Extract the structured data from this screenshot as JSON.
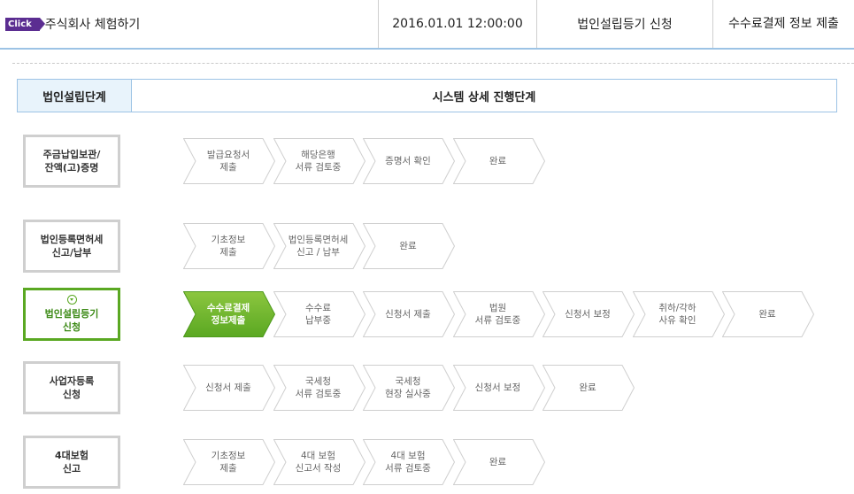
{
  "header": {
    "badge": "Click",
    "title": "주식회사 체험하기",
    "datetime": "2016.01.01 12:00:00",
    "application": "법인설립등기 신청",
    "step": "수수료결제 정보 제출"
  },
  "stage_header": {
    "left": "법인설립단계",
    "right": "시스템 상세 진행단계"
  },
  "rows": [
    {
      "stage": "주금납입보관/\n잔액(고)증명",
      "steps": [
        "발급요청서\n제출",
        "해당은행\n서류 검토중",
        "증명서 확인",
        "완료"
      ]
    },
    {
      "stage": "법인등록면허세\n신고/납부",
      "steps": [
        "기초정보\n제출",
        "법인등록면허세\n신고 / 납부",
        "완료"
      ]
    },
    {
      "stage": "법인설립등기\n신청",
      "active": true,
      "steps": [
        "수수료결제\n정보제출",
        "수수료\n납부중",
        "신청서 제출",
        "법원\n서류 검토중",
        "신청서 보정",
        "취하/각하\n사유 확인",
        "완료"
      ]
    },
    {
      "stage": "사업자등록\n신청",
      "steps": [
        "신청서 제출",
        "국세청\n서류 검토중",
        "국세청\n현장 실사중",
        "신청서 보정",
        "완료"
      ]
    },
    {
      "stage": "4대보험\n신고",
      "steps": [
        "기초정보\n제출",
        "4대 보험\n신고서 작성",
        "4대 보험\n서류 검토중",
        "완료"
      ]
    }
  ],
  "colors": {
    "active_green_top": "#8cc63f",
    "active_green_bottom": "#5aa822",
    "inactive_border": "#cfcfcf",
    "accent_blue": "#9cc3e5"
  }
}
